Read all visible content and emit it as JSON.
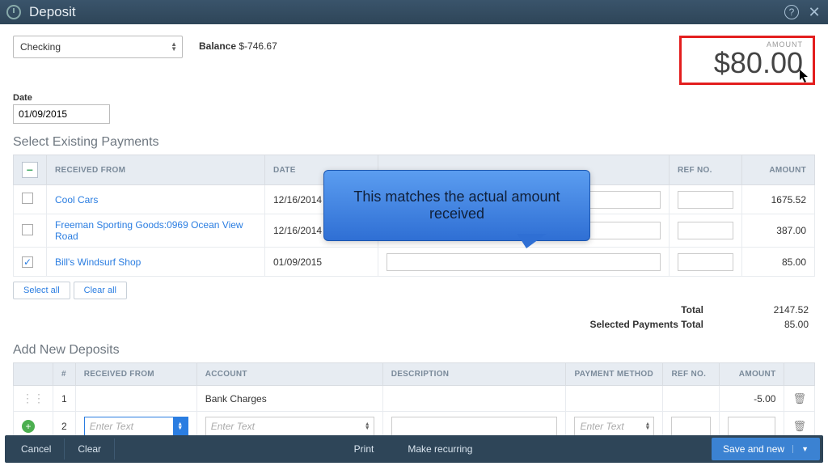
{
  "titlebar": {
    "title": "Deposit"
  },
  "top": {
    "account": "Checking",
    "balance_label": "Balance",
    "balance_value": "$-746.67",
    "amount_label": "AMOUNT",
    "amount_value": "$80.00"
  },
  "date": {
    "label": "Date",
    "value": "01/09/2015"
  },
  "existing": {
    "title": "Select Existing Payments",
    "cols": {
      "received_from": "RECEIVED FROM",
      "date": "DATE",
      "ref_no": "REF NO.",
      "amount": "AMOUNT"
    },
    "rows": [
      {
        "checked": false,
        "received_from": "Cool Cars",
        "date": "12/16/2014",
        "ref_no": "",
        "amount": "1675.52"
      },
      {
        "checked": false,
        "received_from": "Freeman Sporting Goods:0969 Ocean View Road",
        "date": "12/16/2014",
        "ref_no": "",
        "amount": "387.00"
      },
      {
        "checked": true,
        "received_from": "Bill's Windsurf Shop",
        "date": "01/09/2015",
        "ref_no": "",
        "amount": "85.00"
      }
    ],
    "select_all": "Select all",
    "clear_all": "Clear all",
    "total_label": "Total",
    "total_value": "2147.52",
    "selected_label": "Selected Payments Total",
    "selected_value": "85.00"
  },
  "newdep": {
    "title": "Add New Deposits",
    "cols": {
      "num": "#",
      "received_from": "RECEIVED FROM",
      "account": "ACCOUNT",
      "description": "DESCRIPTION",
      "payment_method": "PAYMENT METHOD",
      "ref_no": "REF NO.",
      "amount": "AMOUNT"
    },
    "rows": [
      {
        "num": "1",
        "received_from": "",
        "account": "Bank Charges",
        "description": "",
        "payment_method": "",
        "ref_no": "",
        "amount": "-5.00"
      },
      {
        "num": "2",
        "received_from_ph": "Enter Text",
        "account_ph": "Enter Text",
        "description": "",
        "payment_method_ph": "Enter Text",
        "ref_no": "",
        "amount": ""
      }
    ]
  },
  "footer": {
    "cancel": "Cancel",
    "clear": "Clear",
    "print": "Print",
    "recurring": "Make recurring",
    "save": "Save and new"
  },
  "callout": "This matches the actual amount received",
  "colors": {
    "accent": "#2a7de1",
    "highlight_border": "#e31e1e"
  }
}
